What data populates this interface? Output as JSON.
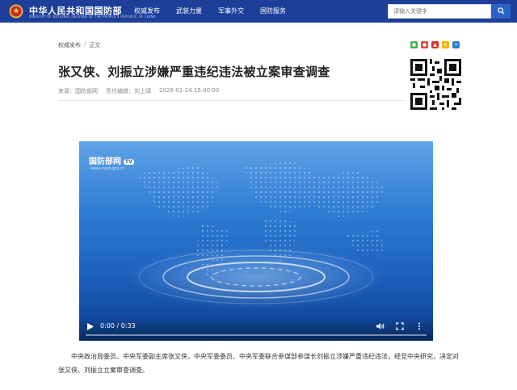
{
  "header": {
    "site_title": "中华人民共和国国防部",
    "site_subtitle": "MINISTRY OF NATIONAL DEFENSE OF THE PEOPLE'S REPUBLIC OF CHINA",
    "nav": [
      "权威发布",
      "武装力量",
      "军事外交",
      "国防服务"
    ],
    "search_placeholder": "请输入关键字"
  },
  "breadcrumb": {
    "home": "权威发布",
    "separator": "/",
    "current": "正文"
  },
  "article": {
    "title": "张又侠、刘振立涉嫌严重违纪违法被立案审查调查",
    "source_label": "来源：",
    "source": "国防部网",
    "editor_label": "责任编辑：",
    "editor": "刘上靖",
    "datetime": "2026-01-24 15:00:00",
    "body": "中央政治局委员、中央军委副主席张又侠，中央军委委员、中央军委联合参谋部参谋长刘振立涉嫌严重违纪违法，经党中央研究，决定对张又侠、刘振立立案审查调查。"
  },
  "video": {
    "logo": "国防部网",
    "logo_badge": "TV",
    "logo_url": "www.mod.gov.cn",
    "time": "0:00 / 0:33",
    "progress": 0.0
  },
  "share": {
    "icons": [
      "wechat-icon",
      "weibo-icon",
      "renren-icon",
      "favorite-icon",
      "more-share-icon"
    ],
    "colors": [
      "#3bb54a",
      "#e0443a",
      "#d9332b",
      "#f4b400",
      "#2a7fd4"
    ]
  }
}
